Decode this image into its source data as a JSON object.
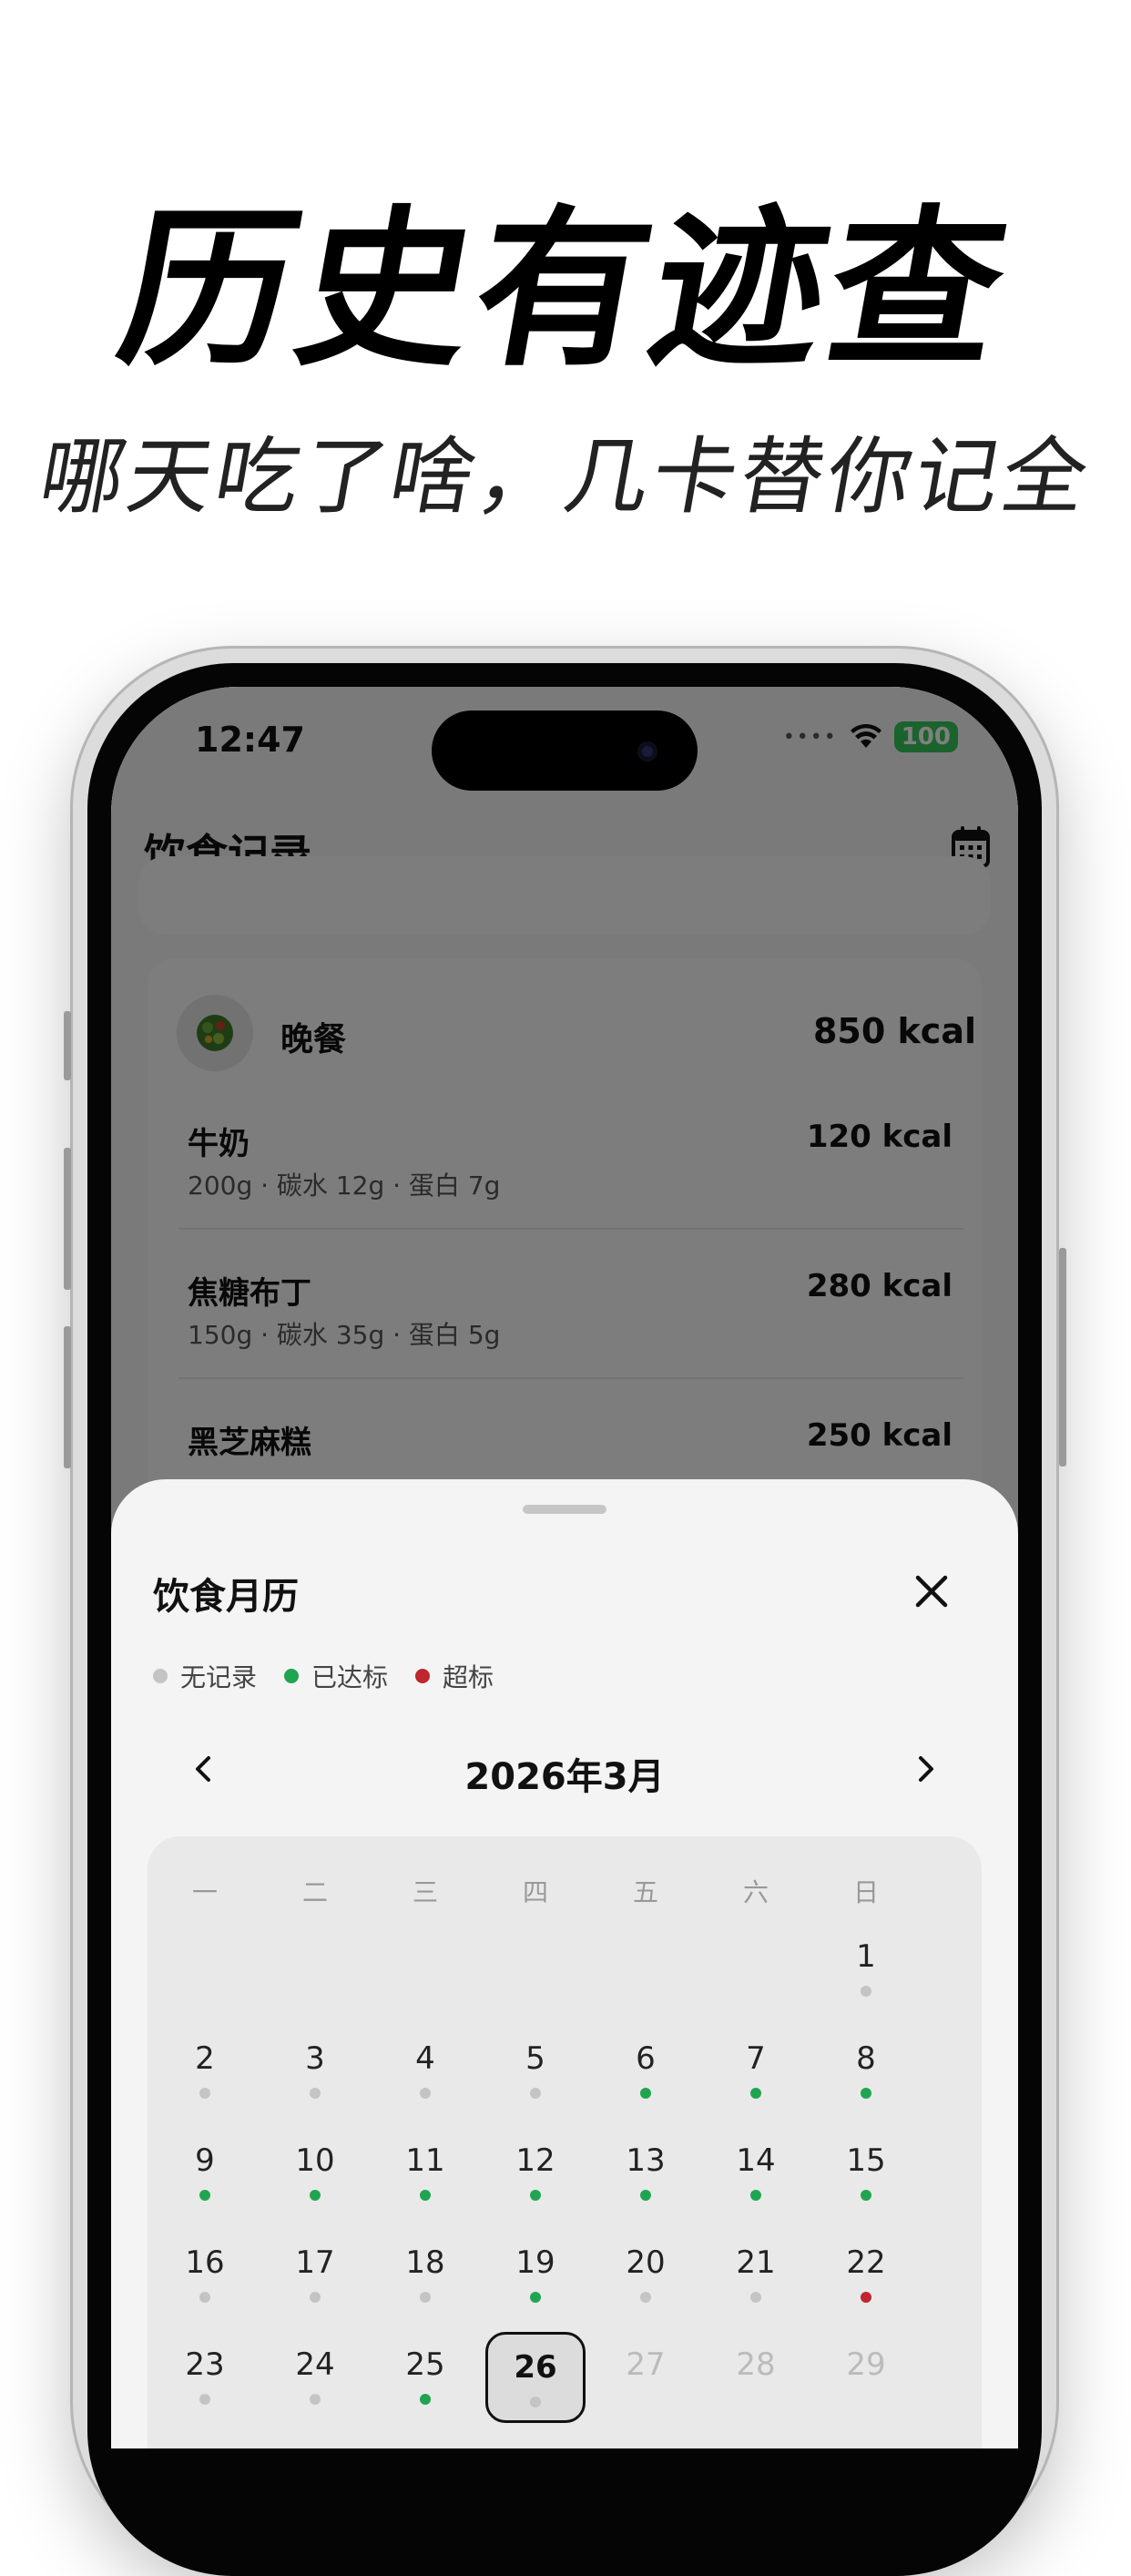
{
  "promo": {
    "headline": "历史有迹查",
    "subline": "哪天吃了啥，几卡替你记全"
  },
  "status_bar": {
    "time": "12:47",
    "signal": "••••",
    "battery": "100"
  },
  "nav": {
    "title": "饮食记录",
    "calendar_icon": "calendar-icon"
  },
  "meal": {
    "name": "晚餐",
    "kcal": "850 kcal",
    "avatar_icon": "salad-bowl-icon",
    "items": [
      {
        "name": "牛奶",
        "kcal": "120 kcal",
        "detail": "200g · 碳水 12g · 蛋白 7g"
      },
      {
        "name": "焦糖布丁",
        "kcal": "280 kcal",
        "detail": "150g · 碳水 35g · 蛋白 5g"
      },
      {
        "name": "黑芝麻糕",
        "kcal": "250 kcal",
        "detail": ""
      }
    ]
  },
  "sheet": {
    "title": "饮食月历",
    "legend": {
      "none": "无记录",
      "met": "已达标",
      "over": "超标"
    },
    "month": "2026年3月",
    "weekdays": [
      "一",
      "二",
      "三",
      "四",
      "五",
      "六",
      "日"
    ],
    "colors": {
      "none": "#c4c4c4",
      "met": "#1fa550",
      "over": "#c0262d"
    },
    "days": [
      {
        "d": "1",
        "s": "none"
      },
      {
        "d": "2",
        "s": "none"
      },
      {
        "d": "3",
        "s": "none"
      },
      {
        "d": "4",
        "s": "none"
      },
      {
        "d": "5",
        "s": "none"
      },
      {
        "d": "6",
        "s": "met"
      },
      {
        "d": "7",
        "s": "met"
      },
      {
        "d": "8",
        "s": "met"
      },
      {
        "d": "9",
        "s": "met"
      },
      {
        "d": "10",
        "s": "met"
      },
      {
        "d": "11",
        "s": "met"
      },
      {
        "d": "12",
        "s": "met"
      },
      {
        "d": "13",
        "s": "met"
      },
      {
        "d": "14",
        "s": "met"
      },
      {
        "d": "15",
        "s": "met"
      },
      {
        "d": "16",
        "s": "none"
      },
      {
        "d": "17",
        "s": "none"
      },
      {
        "d": "18",
        "s": "none"
      },
      {
        "d": "19",
        "s": "met"
      },
      {
        "d": "20",
        "s": "none"
      },
      {
        "d": "21",
        "s": "none"
      },
      {
        "d": "22",
        "s": "over"
      },
      {
        "d": "23",
        "s": "none"
      },
      {
        "d": "24",
        "s": "none"
      },
      {
        "d": "25",
        "s": "met"
      },
      {
        "d": "26",
        "s": "none",
        "today": true
      },
      {
        "d": "27",
        "s": "future"
      },
      {
        "d": "28",
        "s": "future"
      },
      {
        "d": "29",
        "s": "future"
      }
    ]
  }
}
